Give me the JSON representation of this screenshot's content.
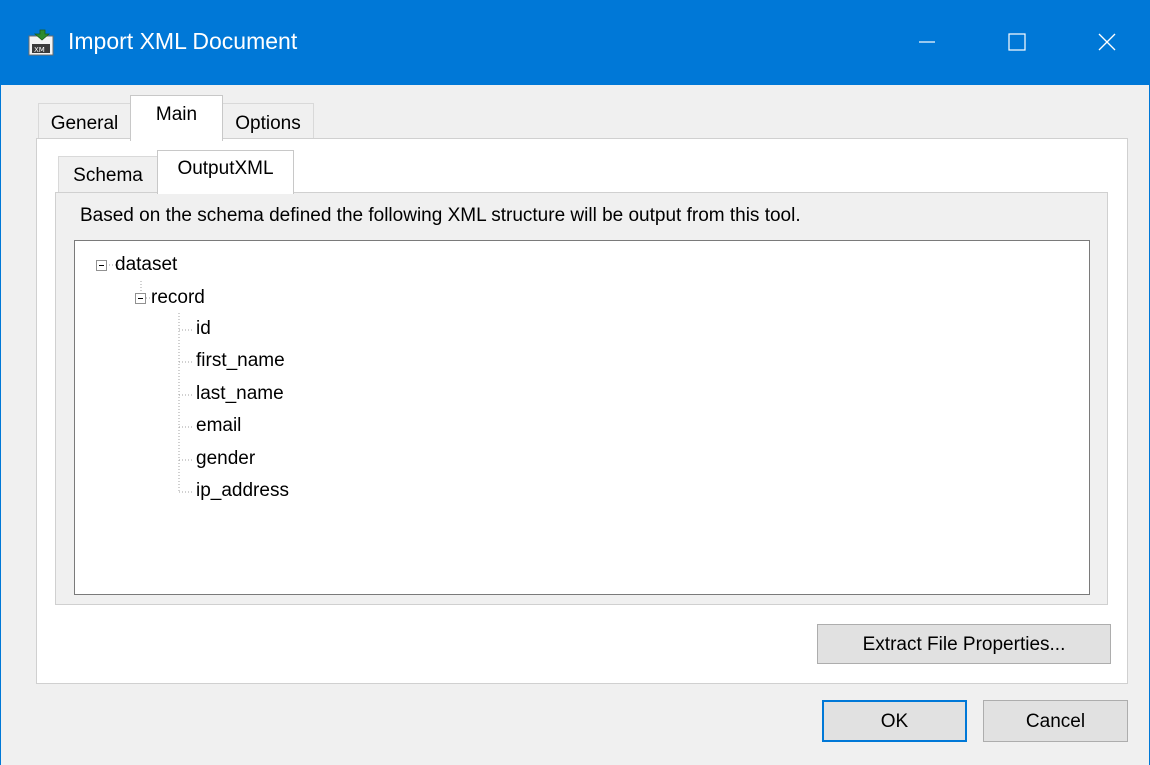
{
  "window": {
    "title": "Import XML Document",
    "icon": "xml-document-icon",
    "accent_color": "#0078d7"
  },
  "tabs": {
    "outer": [
      {
        "label": "General"
      },
      {
        "label": "Main",
        "selected": true
      },
      {
        "label": "Options"
      }
    ],
    "inner": [
      {
        "label": "Schema"
      },
      {
        "label": "OutputXML",
        "selected": true
      }
    ]
  },
  "output_xml": {
    "description": "Based on the schema defined the following XML structure will be output from this tool.",
    "tree": {
      "root": "dataset",
      "child": "record",
      "fields": [
        "id",
        "first_name",
        "last_name",
        "email",
        "gender",
        "ip_address"
      ]
    }
  },
  "buttons": {
    "extract": "Extract File Properties...",
    "ok": "OK",
    "cancel": "Cancel"
  }
}
